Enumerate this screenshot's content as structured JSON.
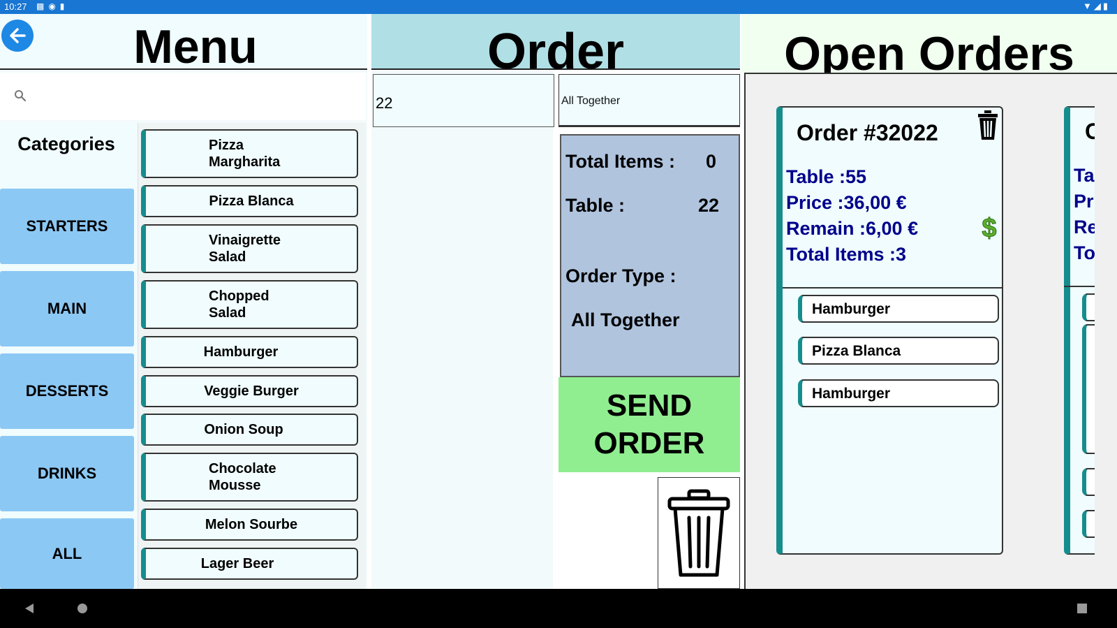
{
  "status_bar": {
    "time": "10:27"
  },
  "menu": {
    "title": "Menu",
    "search": {
      "placeholder": ""
    },
    "categories_title": "Categories",
    "categories": [
      "STARTERS",
      "MAIN",
      "DESSERTS",
      "DRINKS",
      "ALL"
    ],
    "items": [
      [
        "Pizza",
        "Margharita"
      ],
      [
        "Pizza Blanca"
      ],
      [
        "Vinaigrette",
        "Salad"
      ],
      [
        "Chopped",
        "Salad"
      ],
      [
        "Hamburger"
      ],
      [
        "Veggie Burger"
      ],
      [
        "Onion Soup"
      ],
      [
        "Chocolate",
        "Mousse"
      ],
      [
        "Melon Sourbe"
      ],
      [
        "Lager Beer"
      ]
    ]
  },
  "order": {
    "title": "Order",
    "table_input": "22",
    "type_input": "All Together",
    "summary": {
      "total_items_label": "Total Items :",
      "total_items_value": "0",
      "table_label": "Table :",
      "table_value": "22",
      "order_type_label": "Order Type :",
      "order_type_value": "All Together"
    },
    "send_button_line1": "SEND",
    "send_button_line2": "ORDER"
  },
  "open_orders": {
    "title": "Open Orders",
    "cards": [
      {
        "title": "Order #32022",
        "table": "Table :55",
        "price": "Price :36,00 €",
        "remain": "Remain :6,00 €",
        "total_items": "Total Items :3",
        "items": [
          "Hamburger",
          "Pizza Blanca",
          "Hamburger"
        ]
      }
    ],
    "partial_card": {
      "title": "C",
      "table": "Ta",
      "price": "Pr",
      "remain": "Re",
      "total_items": "To"
    }
  },
  "colors": {
    "teal_accent": "#168d8d",
    "category_blue": "#8cc8f4",
    "send_green": "#90ee90",
    "summary_bg": "#b0c4de",
    "order_header": "#b0e0e6",
    "card_text": "#00008b",
    "status_bar": "#1976d2"
  }
}
